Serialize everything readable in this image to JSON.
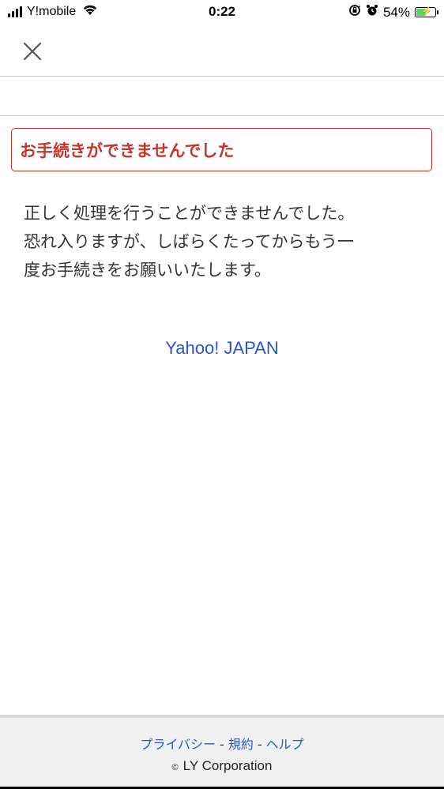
{
  "status_bar": {
    "carrier": "Y!mobile",
    "time": "0:22",
    "battery_percent": "54%",
    "battery_level": 0.54,
    "icons": [
      "signal-icon",
      "wifi-icon",
      "rotation-lock-icon",
      "alarm-icon",
      "battery-charging-icon"
    ]
  },
  "nav": {
    "close_icon": "close-icon"
  },
  "error": {
    "title": "お手続きができませんでした",
    "color": "#c8332c"
  },
  "message": {
    "lines": [
      "正しく処理を行うことができませんでした。",
      "恐れ入りますが、しばらくたってからもう一",
      "度お手続きをお願いいたします。"
    ]
  },
  "home_link": {
    "label": "Yahoo! JAPAN",
    "color": "#2b56c4"
  },
  "footer": {
    "links": [
      "プライバシー",
      "規約",
      "ヘルプ"
    ],
    "separator": "-",
    "copyright_symbol": "©",
    "copyright_text": "LY Corporation"
  }
}
